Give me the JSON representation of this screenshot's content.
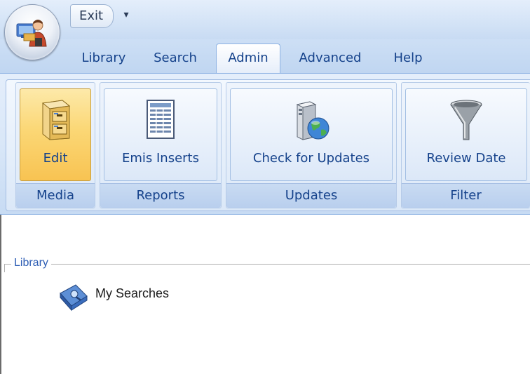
{
  "quick_access": {
    "exit_label": "Exit",
    "dropdown_glyph": "▾"
  },
  "tabs": [
    {
      "label": "Library",
      "active": false
    },
    {
      "label": "Search",
      "active": false
    },
    {
      "label": "Admin",
      "active": true
    },
    {
      "label": "Advanced",
      "active": false
    },
    {
      "label": "Help",
      "active": false
    }
  ],
  "ribbon": {
    "groups": [
      {
        "caption": "Media",
        "button": {
          "label": "Edit",
          "icon": "filing-cabinet-icon",
          "pressed": true
        }
      },
      {
        "caption": "Reports",
        "button": {
          "label": "Emis Inserts",
          "icon": "report-list-icon",
          "pressed": false
        }
      },
      {
        "caption": "Updates",
        "button": {
          "label": "Check for Updates",
          "icon": "server-globe-icon",
          "pressed": false
        }
      },
      {
        "caption": "Filter",
        "button": {
          "label": "Review Date",
          "icon": "funnel-icon",
          "pressed": false
        }
      }
    ]
  },
  "content": {
    "section_label": "Library",
    "items": [
      {
        "label": "My Searches",
        "icon": "searches-book-icon"
      }
    ]
  },
  "colors": {
    "accent_text": "#15428b",
    "pressed_button": "#fbd775",
    "section_label": "#2f5fb5"
  }
}
